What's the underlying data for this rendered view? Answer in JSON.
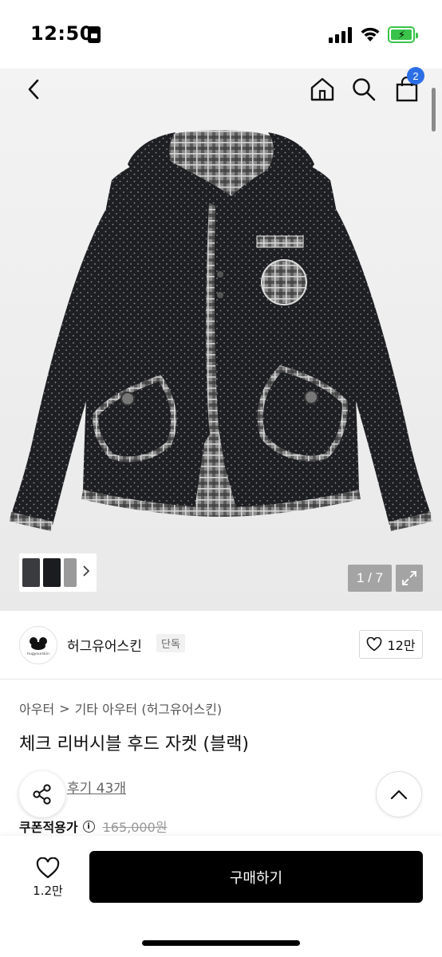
{
  "status": {
    "time": "12:50"
  },
  "cart": {
    "count": "2"
  },
  "gallery": {
    "counter": "1 / 7"
  },
  "brand": {
    "name": "허그유어스킨",
    "tag": "단독",
    "logo_text": "hugyourskin",
    "likes": "12만"
  },
  "breadcrumb": {
    "level1": "아우터",
    "separator": ">",
    "level2": "기타 아우터 (허그유어스킨)"
  },
  "product": {
    "title": "체크 리버시블 후드 자켓 (블랙)",
    "review_link": "후기 43개",
    "coupon_label": "쿠폰적용가",
    "info_glyph": "i",
    "original_price": "165,000원"
  },
  "bottom": {
    "wish_count": "1.2만",
    "buy_label": "구매하기"
  },
  "icons": [
    "back-icon",
    "home-icon",
    "search-icon",
    "shopping-bag-icon",
    "chevron-right-icon",
    "expand-icon",
    "heart-icon",
    "share-icon",
    "chevron-up-icon",
    "info-icon"
  ],
  "colors": {
    "accent_badge": "#2b6ee6",
    "buy_button": "#000000",
    "battery": "#39c34a"
  }
}
